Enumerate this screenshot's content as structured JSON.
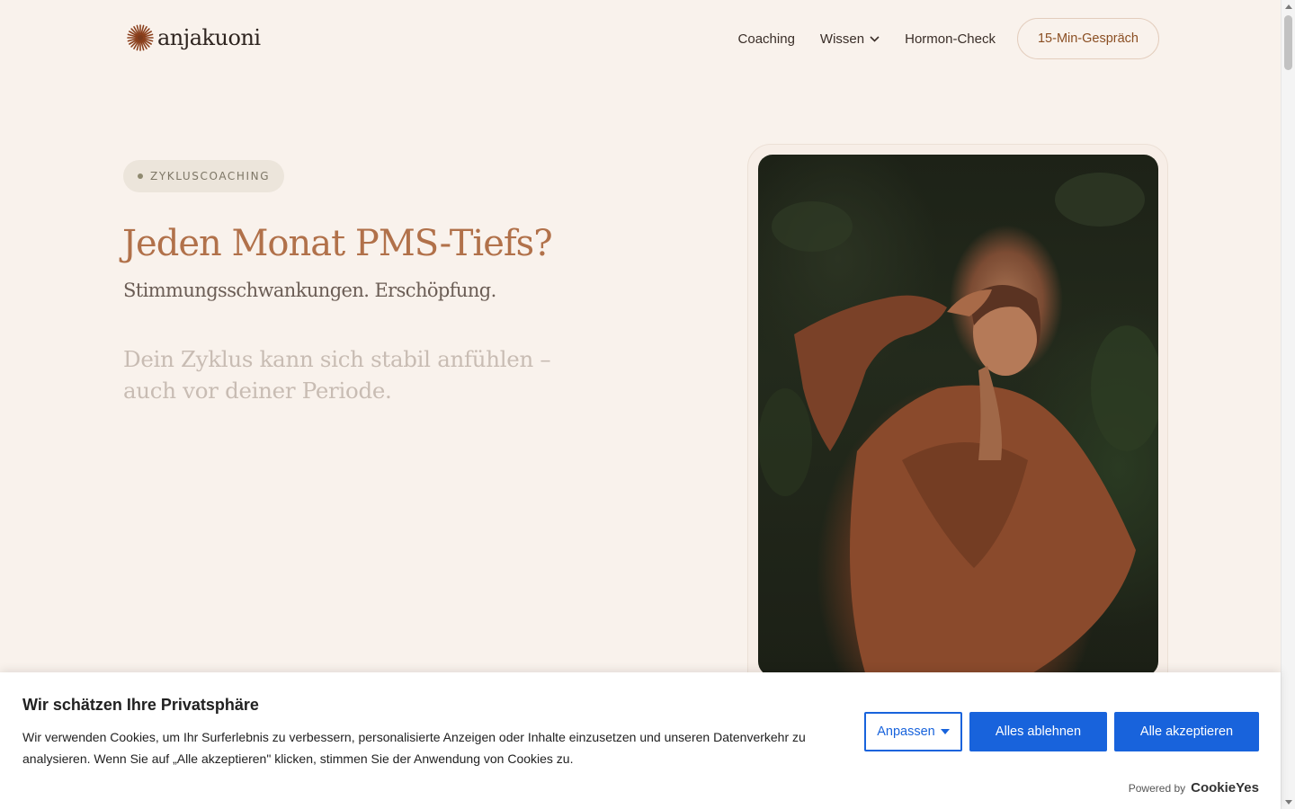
{
  "header": {
    "logo_text": "anjakuoni",
    "nav": {
      "coaching": "Coaching",
      "wissen": "Wissen",
      "hormon_check": "Hormon-Check"
    },
    "cta_label": "15-Min-Gespräch"
  },
  "hero": {
    "badge": "ZYKLUSCOACHING",
    "title": "Jeden Monat PMS-Tiefs?",
    "subtitle": "Stimmungsschwankungen. Erschöpfung.",
    "lead": "Dein Zyklus kann sich stabil anfühlen – auch vor deiner Periode."
  },
  "cookie": {
    "title": "Wir schätzen Ihre Privatsphäre",
    "text": "Wir verwenden Cookies, um Ihr Surferlebnis zu verbessern, personalisierte Anzeigen oder Inhalte einzusetzen und unseren Datenverkehr zu analysieren. Wenn Sie auf „Alle akzeptieren\" klicken, stimmen Sie der Anwendung von Cookies zu.",
    "customize_label": "Anpassen",
    "reject_label": "Alles ablehnen",
    "accept_label": "Alle akzeptieren",
    "powered_by": "Powered by",
    "brand": "CookieYes"
  },
  "colors": {
    "background": "#f9f2ec",
    "accent": "#b1714a",
    "cookie_button": "#1863dc"
  },
  "icons": {
    "logo": "sunburst-logo-icon",
    "dropdown": "chevron-down-icon",
    "customize_caret": "caret-down-icon"
  }
}
